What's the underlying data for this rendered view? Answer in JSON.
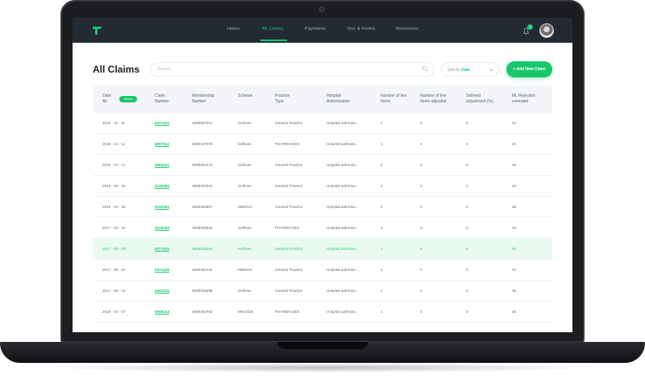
{
  "nav": {
    "items": [
      "Home",
      "All Claims",
      "Payments",
      "Doc & Forms",
      "Resources"
    ],
    "notifications": "2"
  },
  "header": {
    "title": "All Claims",
    "search_placeholder": "Search...",
    "sort_label": "Sort by",
    "sort_value": "Date",
    "add_button": "+ Add New Claim"
  },
  "colors": {
    "accent": "#18c76a",
    "nav_bg": "#232a33"
  },
  "table": {
    "columns": [
      "Date:\nAll",
      "Claim\nNumber",
      "Membership\nNumber",
      "Scheme",
      "Practice\nType",
      "Hospital\nAuthorization",
      "Number of line\nItems",
      "Number of line\nItems adjusted",
      "Sellmed\nadjustment (%)",
      "ML Rejection\nestimator"
    ],
    "select_label": "Select",
    "rows": [
      [
        "2015 - 11 - 11",
        "6317532",
        "4909507071",
        "Selfcare",
        "General Practice",
        "Hospital authroso...",
        "1",
        "0",
        "0",
        "22"
      ],
      [
        "2016 - 01 - 11",
        "6897512",
        "4909107078",
        "Selfcare",
        "PHARMACIES",
        "Hospital authroso...",
        "1",
        "0",
        "0",
        "34"
      ],
      [
        "2016 - 07 - 17",
        "6063421",
        "4909083272",
        "Selfcare",
        "General Practice",
        "Hospital authroso...",
        "2",
        "0",
        "0",
        "36"
      ],
      [
        "2016 - 02 - 23",
        "5132565",
        "4909102944",
        "Selfcare",
        "General Practice",
        "Hospital authroso...",
        "1",
        "0",
        "0",
        "33"
      ],
      [
        "2016 - 04 - 28",
        "5194462",
        "4909062867",
        "MEDXXI",
        "General Practice",
        "Hospital authroso...",
        "2",
        "0",
        "0",
        "28"
      ],
      [
        "2017 - 03 - 22",
        "5228246",
        "4909083642",
        "Selfcare",
        "PHARMACIES",
        "Hospital authroso...",
        "1",
        "0",
        "0",
        "29"
      ],
      [
        "2017 - 08 - 09",
        "5377532",
        "4909038349",
        "Selfcare",
        "General Practice",
        "Hospital authroso...",
        "1",
        "0",
        "0",
        "34"
      ],
      [
        "2017 - 08 - 02",
        "5471426",
        "4909083745",
        "MEDXXI",
        "General Practice",
        "Hospital authroso...",
        "1",
        "0",
        "0",
        "37"
      ],
      [
        "2017 - 09 - 13",
        "5494516",
        "4909028468",
        "Selfcare",
        "General Practice",
        "Hospital authroso...",
        "1",
        "0",
        "0",
        "36"
      ],
      [
        "2018 - 04 - 07",
        "5558313",
        "4909183763",
        "Med Elite",
        "PHARMACIES",
        "Hospital authroso...",
        "1",
        "0",
        "0",
        "35"
      ]
    ]
  }
}
